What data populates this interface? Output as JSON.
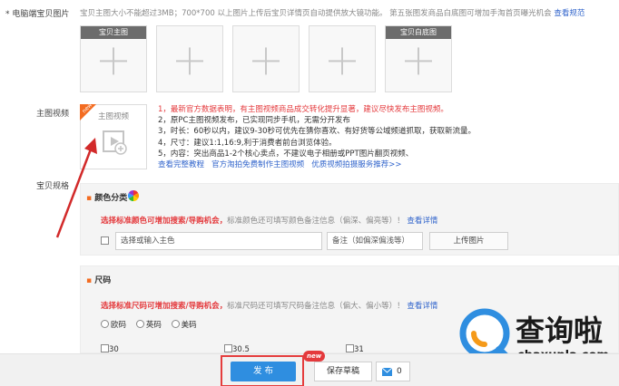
{
  "main_images": {
    "label": "* 电脑端宝贝图片",
    "hint": "宝贝主图大小不能超过3MB；700*700 以上图片上传后宝贝详情页自动提供放大镜功能。 第五张图发商品白底图可增加手淘首页曝光机会",
    "hint_link": "查看规范",
    "slots": [
      {
        "caption": "宝贝主图"
      },
      {
        "caption": ""
      },
      {
        "caption": ""
      },
      {
        "caption": ""
      },
      {
        "caption": "宝贝白底图"
      }
    ]
  },
  "video": {
    "label": "主图视频",
    "thumb_label": "主图视频",
    "new_badge": "new",
    "line1": "1，最新官方数据表明，有主图视频商品成交转化提升显著，建议尽快发布主图视频。",
    "line2": "2，原PC主图视频发布，已实现同步手机，无需分开发布",
    "line3": "3，时长：60秒以内，建议9-30秒可优先在猜你喜欢、有好货等公域频道抓取，获取新流量。",
    "line4": "4，尺寸：建议1:1,16:9,利于消费者前台浏览体验。",
    "line5": "5，内容：突出商品1-2个核心卖点，不建议电子相册或PPT图片翻页视频、",
    "links": [
      "查看完整教程",
      "官方淘拍免费制作主图视频",
      "优质视频拍摄服务推荐>>"
    ]
  },
  "specs": {
    "label": "宝贝规格",
    "color": {
      "title": "颜色分类",
      "tip": "选择标准颜色可增加搜索/导购机会，",
      "tip_rest": "标准颜色还可填写颜色备注信息（偏深、偏亮等）！",
      "tip_link": "查看详情",
      "input_placeholder": "选择或输入主色",
      "remark_placeholder": "备注（如偏深偏浅等）",
      "upload_label": "上传图片"
    },
    "size": {
      "title": "尺码",
      "tip": "选择标准尺码可增加搜索/导购机会，",
      "tip_rest": "标准尺码还可填写尺码备注信息（偏大、偏小等）！",
      "tip_link": "查看详情",
      "options": [
        "欧码",
        "英码",
        "美码"
      ],
      "values": [
        "30",
        "30.5",
        "31"
      ]
    }
  },
  "bottom": {
    "publish_label": "发 布",
    "new_badge": "new",
    "save_draft_label": "保存草稿",
    "message_count": "0"
  },
  "watermark": {
    "title": "查询啦",
    "url": "chaxunla.com"
  },
  "colors": {
    "accent_blue": "#2f8ee0",
    "tip_red": "#e4393c",
    "link_blue": "#3366cc",
    "bullet_orange": "#f36c21"
  }
}
